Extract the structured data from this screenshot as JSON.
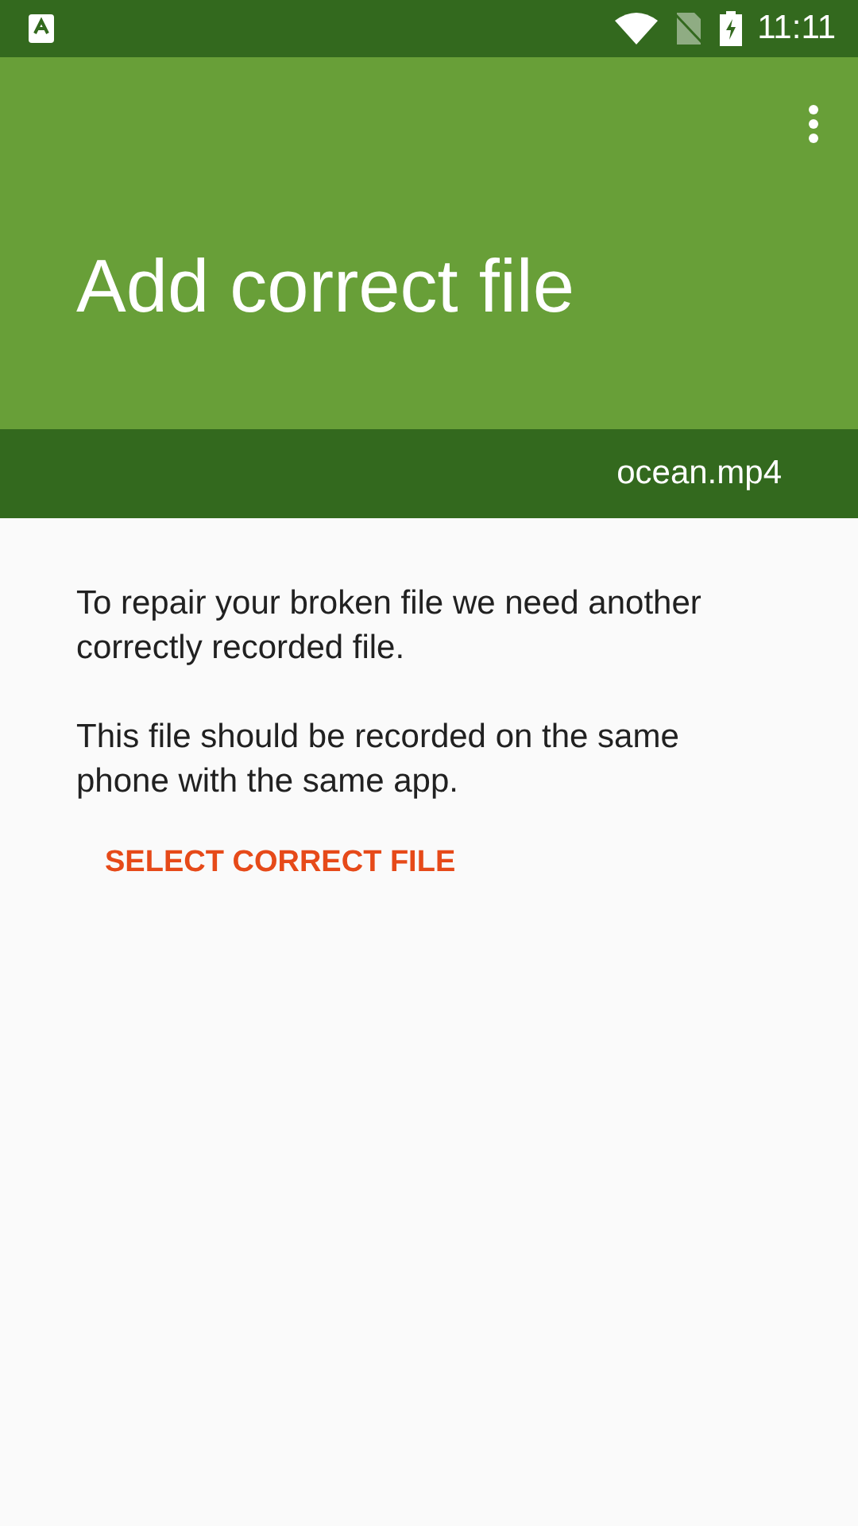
{
  "status_bar": {
    "time": "11:11"
  },
  "app_bar": {
    "title": "Add correct file"
  },
  "file_bar": {
    "file_name": "ocean.mp4"
  },
  "paragraphs": [
    "To repair your broken file we need another correctly recorded file.",
    "This file should be recorded on the same phone with the same app."
  ],
  "action_button": {
    "label": "SELECT CORRECT FILE"
  }
}
